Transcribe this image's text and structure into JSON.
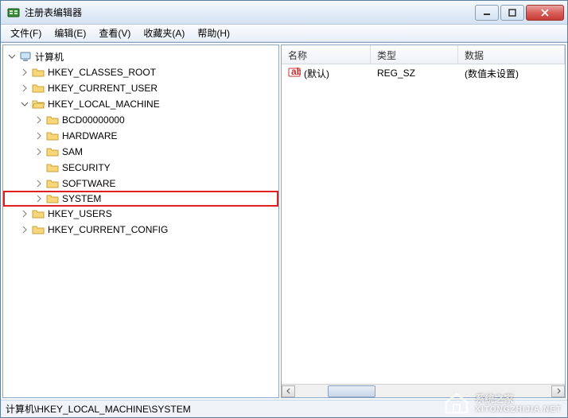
{
  "window": {
    "title": "注册表编辑器"
  },
  "menu": {
    "file": "文件(F)",
    "edit": "编辑(E)",
    "view": "查看(V)",
    "favorites": "收藏夹(A)",
    "help": "帮助(H)"
  },
  "tree": {
    "root": "计算机",
    "hkcr": "HKEY_CLASSES_ROOT",
    "hkcu": "HKEY_CURRENT_USER",
    "hklm": "HKEY_LOCAL_MACHINE",
    "hklm_children": {
      "bcd": "BCD00000000",
      "hardware": "HARDWARE",
      "sam": "SAM",
      "security": "SECURITY",
      "software": "SOFTWARE",
      "system": "SYSTEM"
    },
    "hku": "HKEY_USERS",
    "hkcc": "HKEY_CURRENT_CONFIG"
  },
  "list": {
    "headers": {
      "name": "名称",
      "type": "类型",
      "data": "数据"
    },
    "rows": [
      {
        "name": "(默认)",
        "type": "REG_SZ",
        "data": "(数值未设置)"
      }
    ]
  },
  "statusbar": {
    "path": "计算机\\HKEY_LOCAL_MACHINE\\SYSTEM"
  },
  "watermark": {
    "brand": "系统之家",
    "url": "XITONGZHIJIA.NET"
  }
}
